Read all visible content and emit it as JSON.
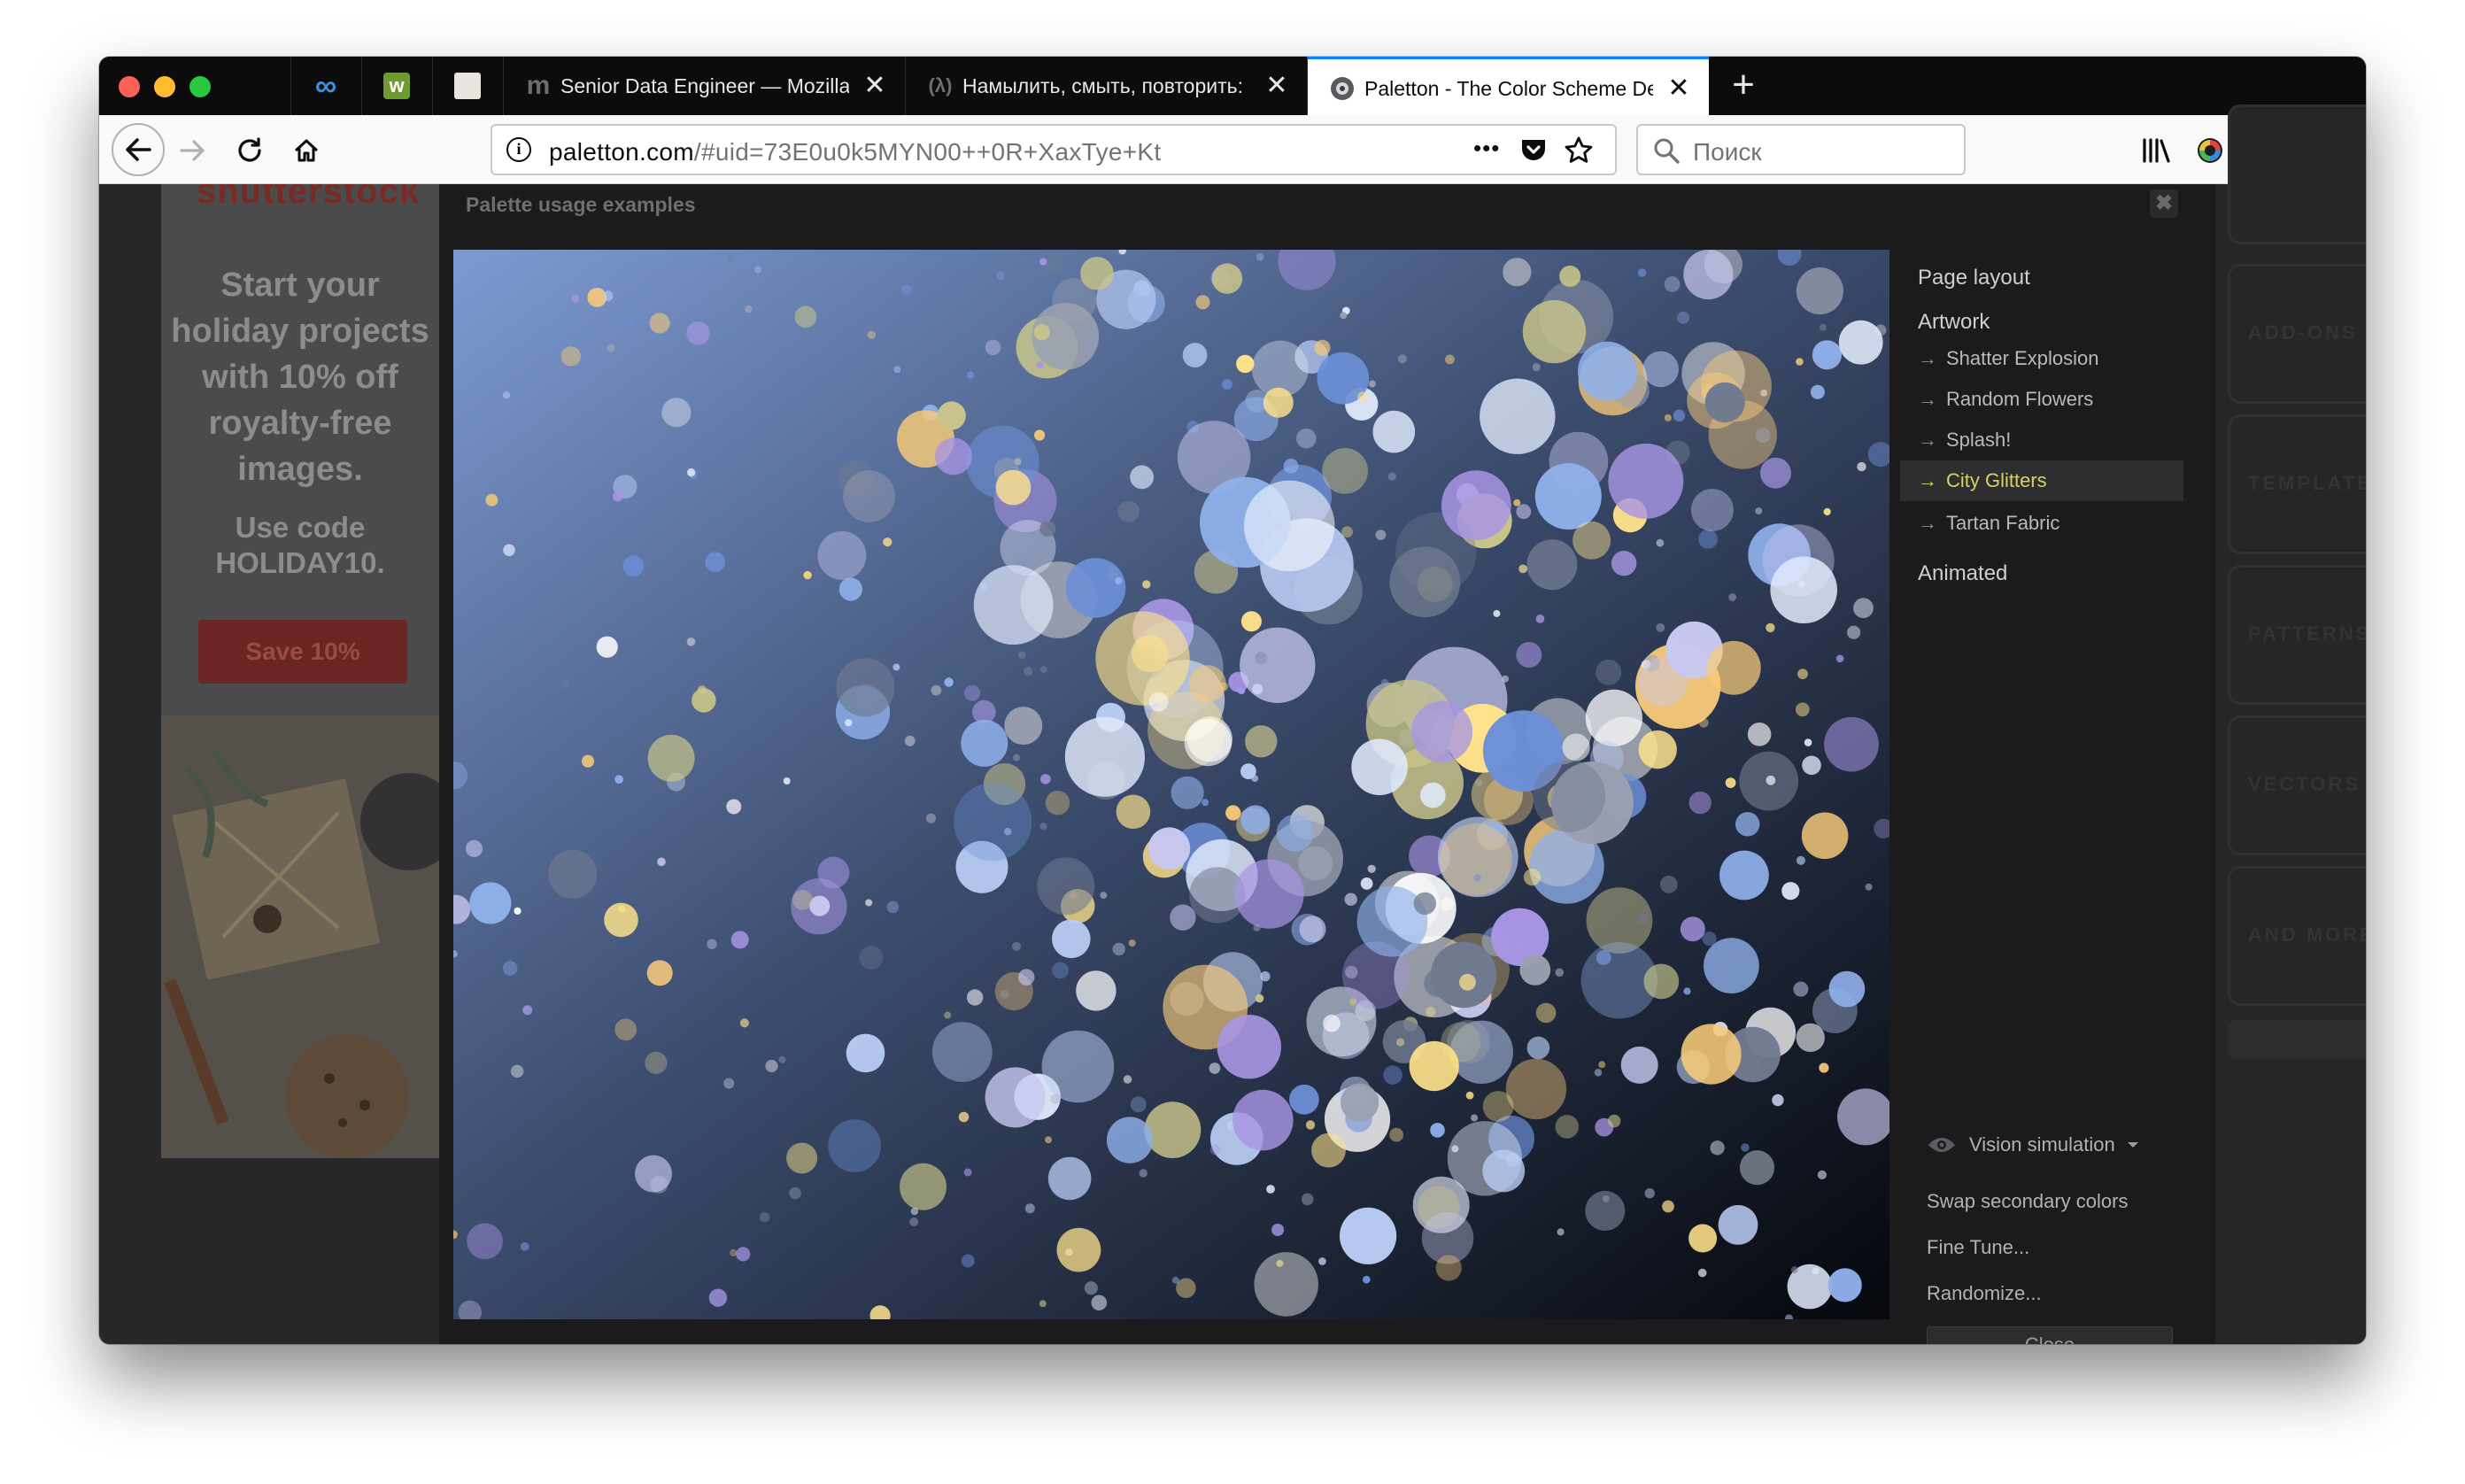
{
  "tabs": [
    {
      "id": "pinned-1",
      "icon": "infinity-icon"
    },
    {
      "id": "pinned-2",
      "icon": "w-icon"
    },
    {
      "id": "pinned-3",
      "icon": "book-icon"
    },
    {
      "id": "tab-1",
      "label": "Senior Data Engineer — Mozilla",
      "icon": "m-icon"
    },
    {
      "id": "tab-2",
      "label": "Намылить, смыть, повторить:",
      "icon": "lambda-icon"
    },
    {
      "id": "tab-3",
      "label": "Paletton - The Color Scheme Designer",
      "icon": "paletton-icon",
      "active": true
    }
  ],
  "new_tab_label": "+",
  "close_glyph": "✕",
  "navbar": {
    "url_domain": "paletton.com",
    "url_rest": "/#uid=73E0u0k5MYN00++0R+XaxTye+Kt",
    "page_actions": "•••",
    "search_placeholder": "Поиск"
  },
  "ad": {
    "logo": "shutterstock",
    "headline": "Start your holiday projects with 10% off royalty-free images.",
    "code": "Use code HOLIDAY10.",
    "button": "Save 10%"
  },
  "right_tabs": [
    "",
    "ADD-ONS",
    "TEMPLATES",
    "PATTERNS",
    "VECTORS",
    "AND MORE",
    ""
  ],
  "modal": {
    "title": "Palette usage examples",
    "close_glyph": "✖",
    "menu": {
      "page_layout": "Page layout",
      "artwork": "Artwork",
      "artwork_items": [
        "Shatter Explosion",
        "Random Flowers",
        "Splash!",
        "City Glitters",
        "Tartan Fabric"
      ],
      "selected": "City Glitters",
      "animated": "Animated",
      "arrow": "→"
    },
    "actions": {
      "vision": "Vision simulation",
      "swap": "Swap secondary colors",
      "fine_tune": "Fine Tune...",
      "randomize": "Randomize...",
      "close": "Close"
    }
  },
  "colors": {
    "accent_selected": "#d7d35e",
    "bokeh_palette": [
      "#ffffff",
      "#dfe9fb",
      "#b9cdf4",
      "#8fb0ea",
      "#6c8fd6",
      "#c8c8f0",
      "#a895e4",
      "#ffe28a",
      "#f7c97a",
      "#c9c58a",
      "#9aa0b0",
      "#6f7a90"
    ]
  }
}
